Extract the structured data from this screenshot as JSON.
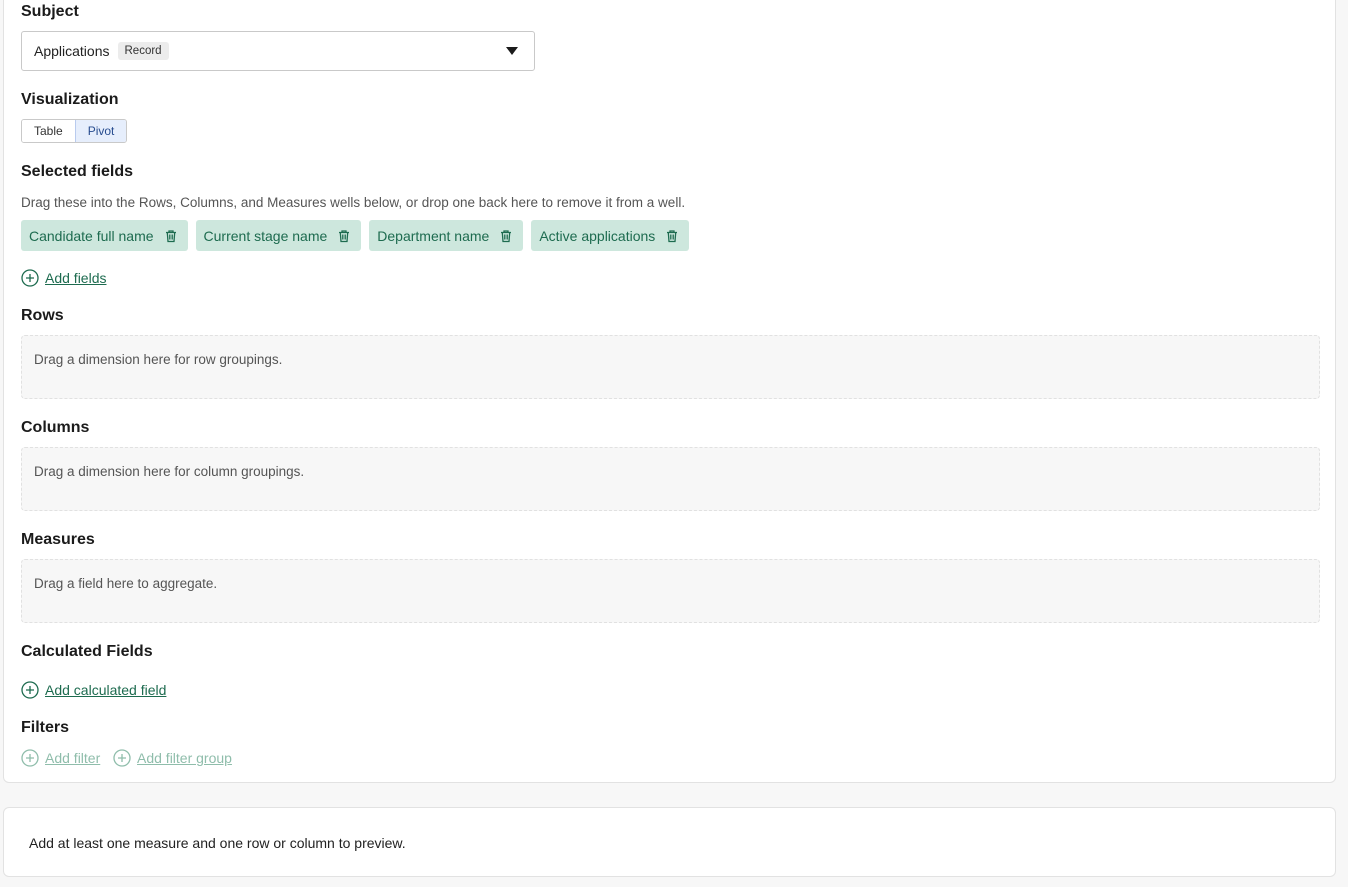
{
  "subject": {
    "title": "Subject",
    "value": "Applications",
    "badge": "Record"
  },
  "visualization": {
    "title": "Visualization",
    "options": [
      "Table",
      "Pivot"
    ],
    "selected": "Pivot"
  },
  "selected_fields": {
    "title": "Selected fields",
    "helper": "Drag these into the Rows, Columns, and Measures wells below, or drop one back here to remove it from a well.",
    "fields": [
      "Candidate full name",
      "Current stage name",
      "Department name",
      "Active applications"
    ],
    "add_label": "Add fields"
  },
  "rows": {
    "title": "Rows",
    "placeholder": "Drag a dimension here for row groupings."
  },
  "columns": {
    "title": "Columns",
    "placeholder": "Drag a dimension here for column groupings."
  },
  "measures": {
    "title": "Measures",
    "placeholder": "Drag a field here to aggregate."
  },
  "calculated": {
    "title": "Calculated Fields",
    "add_label": "Add calculated field"
  },
  "filters": {
    "title": "Filters",
    "add_filter": "Add filter",
    "add_group": "Add filter group"
  },
  "preview": {
    "message": "Add at least one measure and one row or column to preview."
  },
  "colors": {
    "accent": "#1d6b4f",
    "chip_bg": "#cde7dd",
    "disabled": "#8fbdab"
  }
}
